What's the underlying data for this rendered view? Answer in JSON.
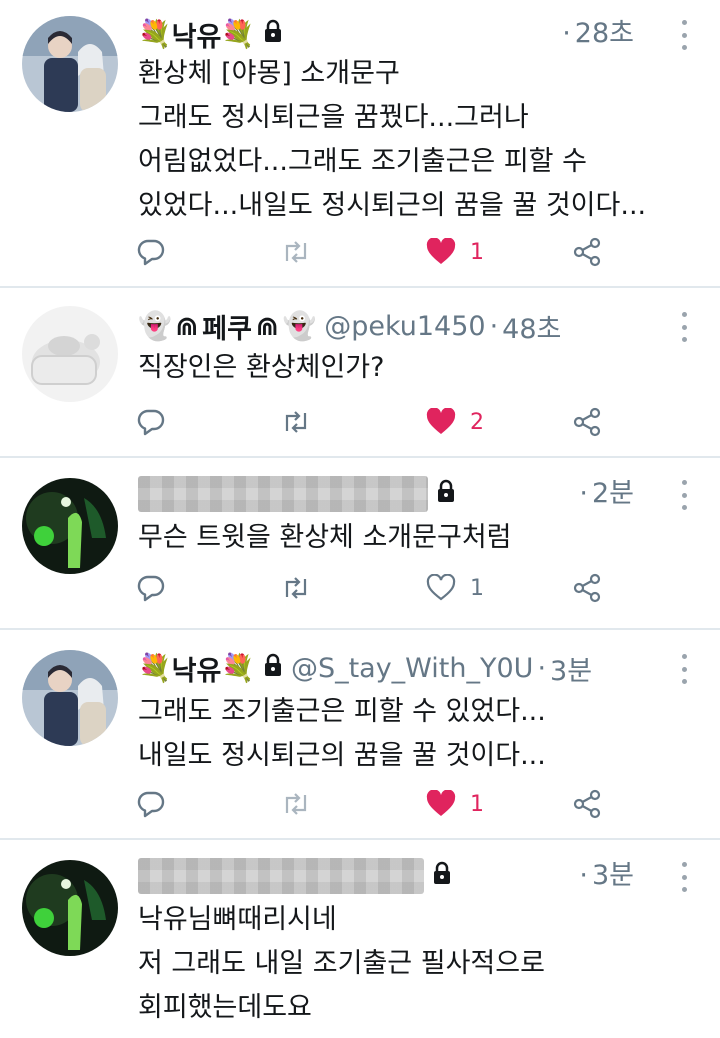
{
  "colors": {
    "like_active": "#e0245e",
    "meta": "#657786",
    "divider": "#e1e8ed"
  },
  "tweets": [
    {
      "name": "낙유",
      "name_emoji": "💐",
      "handle": "",
      "time": "28초",
      "locked": true,
      "text": "환상체 [야몽] 소개문구\n그래도 정시퇴근을 꿈꿨다...그러나\n어림없었다...그래도 조기출근은 피할 수\n있었다...내일도 정시퇴근의 꿈을 꿀 것이다...",
      "likes": "1",
      "liked": true,
      "retweets": ""
    },
    {
      "name": "페쿠",
      "name_emoji": "👻",
      "handle": "@peku1450",
      "time": "48초",
      "locked": false,
      "text": "직장인은 환상체인가?",
      "likes": "2",
      "liked": true,
      "retweets": ""
    },
    {
      "name": "",
      "handle": "",
      "time": "2분",
      "locked": true,
      "text": "무슨 트윗을 환상체 소개문구처럼",
      "likes": "1",
      "liked": false,
      "retweets": ""
    },
    {
      "name": "낙유",
      "name_emoji": "💐",
      "handle": "@S_tay_With_Y0U",
      "time": "3분",
      "locked": true,
      "text": "그래도 조기출근은 피할 수 있었다...\n내일도 정시퇴근의 꿈을 꿀 것이다...",
      "likes": "1",
      "liked": true,
      "retweets": ""
    },
    {
      "name": "",
      "handle": "",
      "time": "3분",
      "locked": true,
      "text": "낙유님뼈때리시네\n저 그래도 내일 조기출근 필사적으로\n회피했는데도요",
      "likes": "",
      "liked": false,
      "retweets": ""
    }
  ],
  "icons": {
    "reply": "reply-icon",
    "retweet": "retweet-icon",
    "like": "heart-icon",
    "share": "share-icon",
    "more": "more-vertical-icon",
    "lock": "lock-icon"
  }
}
